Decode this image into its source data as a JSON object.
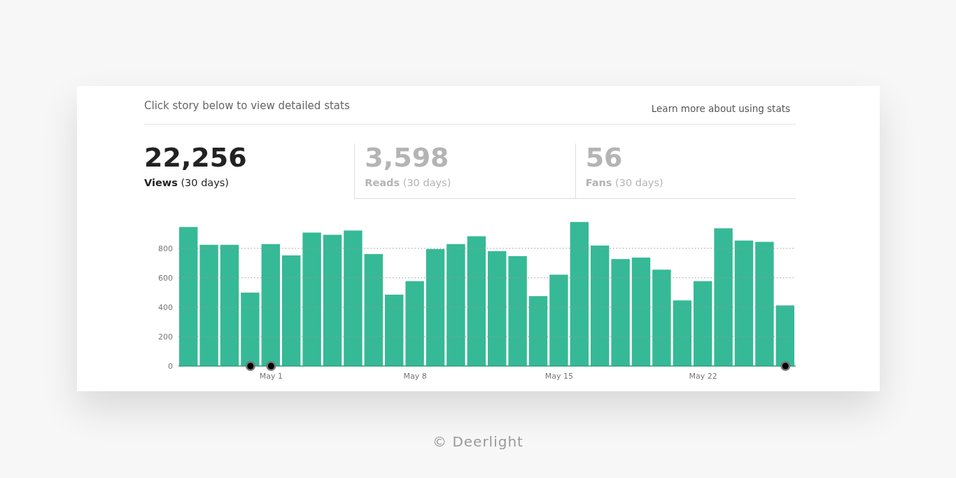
{
  "header": {
    "hint": "Click story below to view detailed stats",
    "link": "Learn more about using stats"
  },
  "tabs": [
    {
      "value": "22,256",
      "label": "**Views** (30 days)",
      "selected": true
    },
    {
      "value": "3,598",
      "label": "**Reads** (30 days)",
      "selected": false
    },
    {
      "value": "56",
      "label": "**Fans** (30 days)",
      "selected": false
    }
  ],
  "chart_data": {
    "type": "bar",
    "categories": [
      null,
      null,
      null,
      null,
      "May 1",
      null,
      null,
      null,
      null,
      null,
      null,
      "May 8",
      null,
      null,
      null,
      null,
      null,
      null,
      "May 15",
      null,
      null,
      null,
      null,
      null,
      null,
      "May 22",
      null,
      null,
      null,
      null
    ],
    "series": [
      {
        "color": "#36b996",
        "values": [
          945,
          824,
          824,
          499,
          829,
          752,
          907,
          892,
          921,
          761,
          485,
          577,
          795,
          829,
          882,
          781,
          747,
          475,
          621,
          979,
          819,
          727,
          737,
          655,
          446,
          577,
          936,
          853,
          844,
          412
        ]
      }
    ],
    "ylim": [
      0,
      980
    ],
    "yticks": [
      0,
      200,
      400,
      600,
      800
    ],
    "grid": true
  },
  "bar_story_markers": [
    false,
    false,
    false,
    true,
    true,
    false,
    false,
    false,
    false,
    false,
    false,
    false,
    false,
    false,
    false,
    false,
    false,
    false,
    false,
    false,
    false,
    false,
    false,
    false,
    false,
    false,
    false,
    false,
    false,
    true
  ],
  "credit": "© Deerlight"
}
